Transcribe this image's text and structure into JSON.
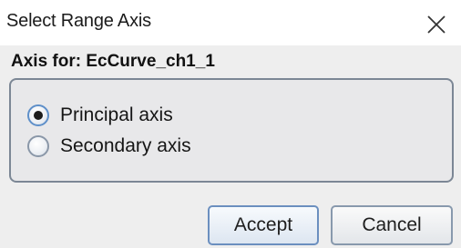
{
  "window": {
    "title": "Select Range Axis",
    "close_icon": "close-icon"
  },
  "panel": {
    "label": "Axis for: EcCurve_ch1_1"
  },
  "options": [
    {
      "label": "Principal axis",
      "checked": true
    },
    {
      "label": "Secondary axis",
      "checked": false
    }
  ],
  "buttons": {
    "accept_label": "Accept",
    "cancel_label": "Cancel"
  },
  "colors": {
    "group_border": "#7c8795",
    "button_border": "#6b8fbf"
  }
}
